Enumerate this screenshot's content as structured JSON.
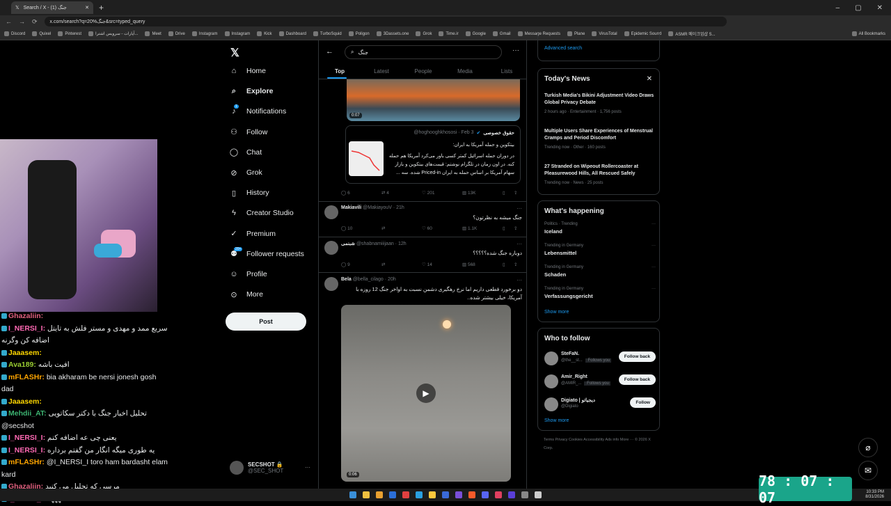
{
  "browser": {
    "tab_title": "Search / X - جنگ (1)",
    "url": "x.com/search?q=جنگ%20&src=typed_query",
    "bookmarks": [
      "Discord",
      "Quixel",
      "Pinterest",
      "آپارات - سرویس اشترا...",
      "Meet",
      "Drive",
      "Instagram",
      "Instagram",
      "Kick",
      "Dashboard",
      "TurboSquid",
      "Poligon",
      "3Dassets.one",
      "Grok",
      "Time.ir",
      "Google",
      "Gmail",
      "Message Requests",
      "Plane",
      "VirusTotal",
      "Epidemic Sound",
      "ASMR 메이크업샵 S...",
      "All Bookmarks"
    ]
  },
  "chat": [
    {
      "user": "Ghazaliin",
      "text": "",
      "color": "#e0607e"
    },
    {
      "user": "I_NERSI_I",
      "text": "سریع ممد و مهدی و مستر فلش به تایتل",
      "color": "#ff69b4"
    },
    {
      "user": "",
      "text": "اضافه کن وگرنه",
      "color": "#fff"
    },
    {
      "user": "Jaaasem",
      "text": "",
      "color": "#ffd700"
    },
    {
      "user": "Ava189",
      "text": "افیت باشه",
      "color": "#9acd32"
    },
    {
      "user": "mFLASHr",
      "text": "bia akharam be nersi jonesh gosh",
      "color": "#ffa500"
    },
    {
      "user": "",
      "text": "dad",
      "color": "#fff"
    },
    {
      "user": "Jaaasem",
      "text": "",
      "color": "#ffd700"
    },
    {
      "user": "Mehdii_AT",
      "text": "تحلیل اخبار جنگ با دکتر سکاتویی",
      "color": "#3cb371"
    },
    {
      "user": "",
      "text": "@secshot",
      "color": "#fff"
    },
    {
      "user": "I_NERSI_I",
      "text": "یعنی چی عه اضافه کنم",
      "color": "#ff69b4"
    },
    {
      "user": "I_NERSI_I",
      "text": "یه طوری میگه انگار من گفتم برداره",
      "color": "#ff69b4"
    },
    {
      "user": "mFLASHr",
      "text": "@I_NERSI_I toro ham bardasht elam",
      "color": "#ffa500"
    },
    {
      "user": "",
      "text": "kard",
      "color": "#fff"
    },
    {
      "user": "Ghazaliin",
      "text": "مرسی که تحلیل می کنید",
      "color": "#e0607e"
    },
    {
      "user": "I_NERSI_I",
      "text": "عهههه",
      "color": "#ff69b4"
    }
  ],
  "nav": {
    "items": [
      {
        "label": "Home",
        "icon": "home-icon"
      },
      {
        "label": "Explore",
        "icon": "search-icon"
      },
      {
        "label": "Notifications",
        "icon": "bell-icon"
      },
      {
        "label": "Follow",
        "icon": "person-plus-icon"
      },
      {
        "label": "Chat",
        "icon": "chat-icon"
      },
      {
        "label": "Grok",
        "icon": "grok-icon"
      },
      {
        "label": "History",
        "icon": "bookmark-icon"
      },
      {
        "label": "Creator Studio",
        "icon": "lightning-icon"
      },
      {
        "label": "Premium",
        "icon": "verified-icon"
      },
      {
        "label": "Follower requests",
        "icon": "people-icon"
      },
      {
        "label": "Profile",
        "icon": "person-icon"
      },
      {
        "label": "More",
        "icon": "more-circle-icon"
      }
    ],
    "notif_badge": "1",
    "requests_badge": "20+",
    "post_label": "Post",
    "account_name": "SECSHOT 🔒",
    "account_handle": "@SEC_SHOT"
  },
  "search": {
    "query": "جنگ",
    "tabs": [
      "Top",
      "Latest",
      "People",
      "Media",
      "Lists"
    ]
  },
  "posts": {
    "first_video_time": "0:07",
    "quote": {
      "name": "حقوق خصوصی",
      "handle": "@hoghooghkhososi · Feb 3",
      "title": "بیتکوین و حمله آمریکا به ایران:",
      "body": "در دوران حمله اسرائیل کمتر کسی باور می‌کرد آمریکا هم حمله کنه. در اون زمان در تلگرام نوشتم: قیمت‌های بیتکوین و بازار سهام آمریکا بر اساس حمله به ایران Priced-in شده. سه ..."
    },
    "stats1": [
      "6",
      "4",
      "201",
      "13K"
    ],
    "tweet2": {
      "name": "Makiavili",
      "handle": "@MakiayouV · 21h",
      "text": "جنگ میشه به نظرتون؟",
      "stats": [
        "10",
        "",
        "60",
        "1.1K"
      ]
    },
    "tweet3": {
      "name": "شبنمی",
      "handle": "@shabnamiiijaan · 12h",
      "text": "دوباره جنگ شده؟؟؟؟؟",
      "stats": [
        "9",
        "",
        "14",
        "568"
      ]
    },
    "tweet4": {
      "name": "Bela",
      "handle": "@bella_cilago · 20h",
      "text": "دو برخورد قطعی داریم اما نرخ رهگیری دشمن نسبت به اواخر جنگ 12 روزه با آمریکا، خیلی بیشتر شده..",
      "video_time": "0:06"
    }
  },
  "sidebar": {
    "advanced_search": "Advanced search",
    "todays_news_title": "Today's News",
    "news": [
      {
        "title": "Turkish Media's Bikini Adjustment Video Draws Global Privacy Debate",
        "meta": "2 hours ago · Entertainment · 1,756 posts"
      },
      {
        "title": "Multiple Users Share Experiences of Menstrual Cramps and Period Discomfort",
        "meta": "Trending now · Other · 160 posts"
      },
      {
        "title": "27 Stranded on Wipeout Rollercoaster at Pleasurewood Hills, All Rescued Safely",
        "meta": "Trending now · News · 25 posts"
      }
    ],
    "happening_title": "What's happening",
    "trends": [
      {
        "context": "Politics · Trending",
        "name": "Iceland"
      },
      {
        "context": "Trending in Germany",
        "name": "Lebensmittel"
      },
      {
        "context": "Trending in Germany",
        "name": "Schaden"
      },
      {
        "context": "Trending in Germany",
        "name": "Verfassungsgericht"
      }
    ],
    "show_more": "Show more",
    "who_title": "Who to follow",
    "follow": [
      {
        "name": "SteFaN.",
        "handle": "@the__st...",
        "tag": "Follows you",
        "btn": "Follow back"
      },
      {
        "name": "Amir_Right",
        "handle": "@AMIR_...",
        "tag": "Follows you",
        "btn": "Follow back"
      },
      {
        "name": "Digiato | دیجیاتو",
        "handle": "@Digiato",
        "tag": "",
        "btn": "Follow"
      }
    ],
    "footer": "Terms   Privacy   Cookies   Accessibility   Ads info   More ···   © 2026 X Corp."
  },
  "timer": "78 : 07 : 07",
  "clock": {
    "time": "10:33 PM",
    "date": "8/31/2026"
  }
}
